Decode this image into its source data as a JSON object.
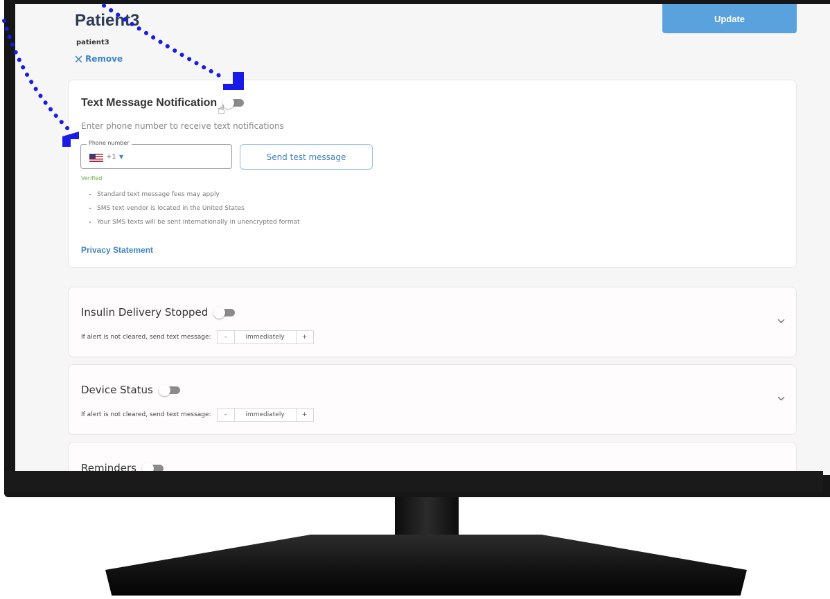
{
  "header": {
    "title": "Patient3",
    "username": "patient3",
    "remove_label": "Remove",
    "update_label": "Update"
  },
  "text_notification": {
    "title": "Text Message Notification",
    "subtitle": "Enter phone number to receive text notifications",
    "toggle_on": false,
    "phone_label": "Phone number",
    "dial_code": "+1",
    "phone_value": "",
    "send_test_label": "Send test message",
    "verified_label": "Verified",
    "notes": [
      "Standard text message fees may apply",
      "SMS text vendor is located in the United States",
      "Your SMS texts will be sent internationally in unencrypted format"
    ],
    "privacy_label": "Privacy Statement"
  },
  "alerts": {
    "insulin": {
      "title": "Insulin Delivery Stopped",
      "toggle_on": false,
      "send_label": "If alert is not cleared, send text message:",
      "minus": "-",
      "value": "immediately",
      "plus": "+"
    },
    "device": {
      "title": "Device Status",
      "toggle_on": false,
      "send_label": "If alert is not cleared, send text message:",
      "minus": "-",
      "value": "immediately",
      "plus": "+"
    },
    "reminders": {
      "title": "Reminders",
      "toggle_on": false
    }
  },
  "icons": {
    "remove": "close-icon",
    "expand": "chevron-down-icon",
    "dial_dropdown": "caret-down-icon",
    "country": "us-flag-icon",
    "cursor": "hand-pointer-icon"
  },
  "colors": {
    "accent": "#3f84c6",
    "update_button": "#5aa2dd",
    "title": "#2d3a55",
    "verified": "#6dae4d",
    "annotation": "#1a1ae6",
    "toggle_track": "#8b8b8b"
  }
}
